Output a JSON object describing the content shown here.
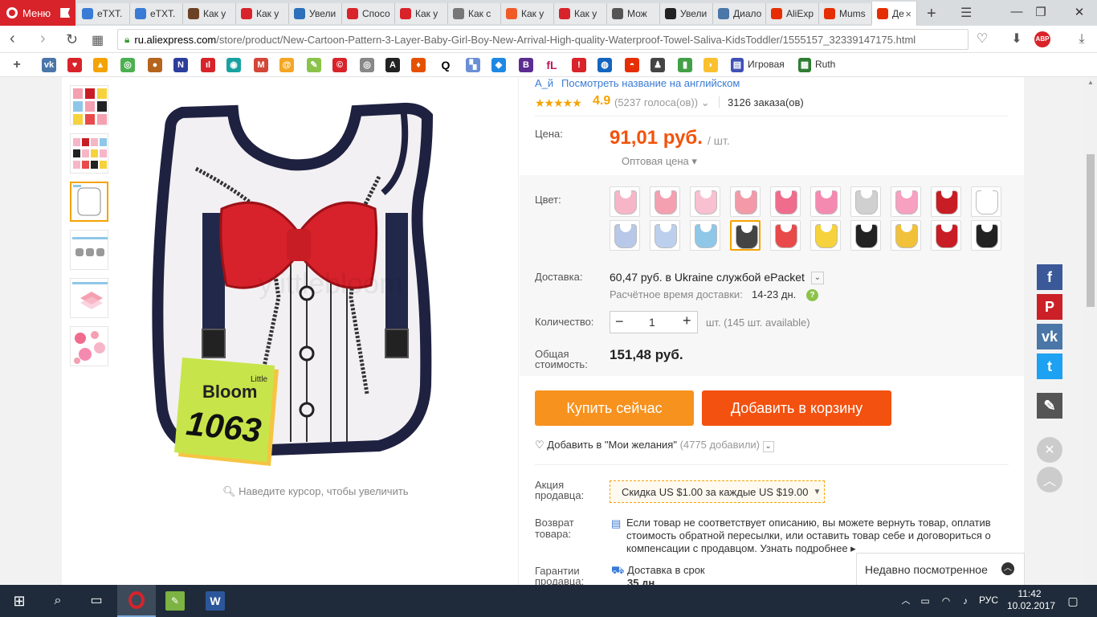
{
  "browser": {
    "menu_label": "Меню",
    "tabs": [
      {
        "label": "eTXT.",
        "color": "#3a7bd5"
      },
      {
        "label": "eTXT.",
        "color": "#3a7bd5"
      },
      {
        "label": "Как у",
        "color": "#6b4226"
      },
      {
        "label": "Как у",
        "color": "#d8232a"
      },
      {
        "label": "Увели",
        "color": "#2c6fbb"
      },
      {
        "label": "Спосо",
        "color": "#d8232a"
      },
      {
        "label": "Как у",
        "color": "#d8232a"
      },
      {
        "label": "Как с",
        "color": "#777777"
      },
      {
        "label": "Как у",
        "color": "#f05a28"
      },
      {
        "label": "Как у",
        "color": "#d8232a"
      },
      {
        "label": "Мож",
        "color": "#555555"
      },
      {
        "label": "Увели",
        "color": "#222222"
      },
      {
        "label": "Диало",
        "color": "#4a76a8"
      },
      {
        "label": "AliExp",
        "color": "#e62e04"
      },
      {
        "label": "Mums",
        "color": "#e62e04"
      },
      {
        "label": "Де",
        "color": "#e62e04"
      }
    ],
    "url_domain": "ru.aliexpress.com",
    "url_path": "/store/product/New-Cartoon-Pattern-3-Layer-Baby-Girl-Boy-New-Arrival-High-quality-Waterproof-Towel-Saliva-KidsToddler/1555157_32339147175.html",
    "abp_label": "ABP",
    "bookmarks_text": [
      "Игровая",
      "Ruth"
    ]
  },
  "product": {
    "translate_link": "Посмотреть название на английском",
    "rating": "4.9",
    "votes": "(5237 голоса(ов))",
    "orders": "3126 заказа(ов)",
    "price_label": "Цена:",
    "price": "91,01 руб.",
    "price_unit": "/ шт.",
    "wholesale": "Оптовая цена",
    "color_label": "Цвет:",
    "swatch_colors": [
      "#f7b6c8",
      "#f4a0b0",
      "#f8c0d0",
      "#f29aa8",
      "#f06c8c",
      "#f58ab0",
      "#d0d0d0",
      "#f7a0c0",
      "#c81d25",
      "#ffffff",
      "#b8c8e8",
      "#bcd0ee",
      "#8fc7e8",
      "#444444",
      "#e84a4a",
      "#f6d23c",
      "#222222",
      "#f2c13a",
      "#c81d25",
      "#222222"
    ],
    "delivery_label": "Доставка:",
    "delivery": "60,47 руб. в Ukraine службой ePacket",
    "delivery_time_label": "Расчётное время доставки:",
    "delivery_time": "14-23 дн.",
    "qty_label": "Количество:",
    "qty": "1",
    "qty_available": "шт. (145 шт. available)",
    "total_label_1": "Общая",
    "total_label_2": "стоимость:",
    "total": "151,48 руб.",
    "buy_now": "Купить сейчас",
    "add_to_cart": "Добавить в корзину",
    "wishlist": "Добавить в \"Мои желания\"",
    "wishlist_count": "(4775 добавили)",
    "promo_label_1": "Акция",
    "promo_label_2": "продавца:",
    "promo": "Скидка US $1.00 за каждые US $19.00",
    "return_label_1": "Возврат",
    "return_label_2": "товара:",
    "return_text": "Если товар не соответствует описанию, вы можете вернуть товар, оплатив стоимость обратной пересылки, или оставить товар себе и договориться о компенсации с продавцом. Узнать подробнее ▸",
    "guarantee_label_1": "Гарантии",
    "guarantee_label_2": "продавца:",
    "guarantee_text": "Доставка в срок",
    "guarantee_days": "35 дн.",
    "zoom_hint": "Наведите курсор, чтобы увеличить",
    "sticker_brand": "Bloom",
    "sticker_little": "Little",
    "sticker_number": "1063",
    "watermark": "ylittlebloom"
  },
  "recent": "Недавно посмотренное",
  "social": [
    {
      "name": "facebook",
      "glyph": "f",
      "color": "#3b5998"
    },
    {
      "name": "pinterest",
      "glyph": "P",
      "color": "#cb2027"
    },
    {
      "name": "vk",
      "glyph": "vk",
      "color": "#4a76a8"
    },
    {
      "name": "twitter",
      "glyph": "t",
      "color": "#1da1f2"
    },
    {
      "name": "edit",
      "glyph": "✎",
      "color": "#555555"
    }
  ],
  "taskbar": {
    "lang": "РУС",
    "time": "11:42",
    "date": "10.02.2017"
  }
}
